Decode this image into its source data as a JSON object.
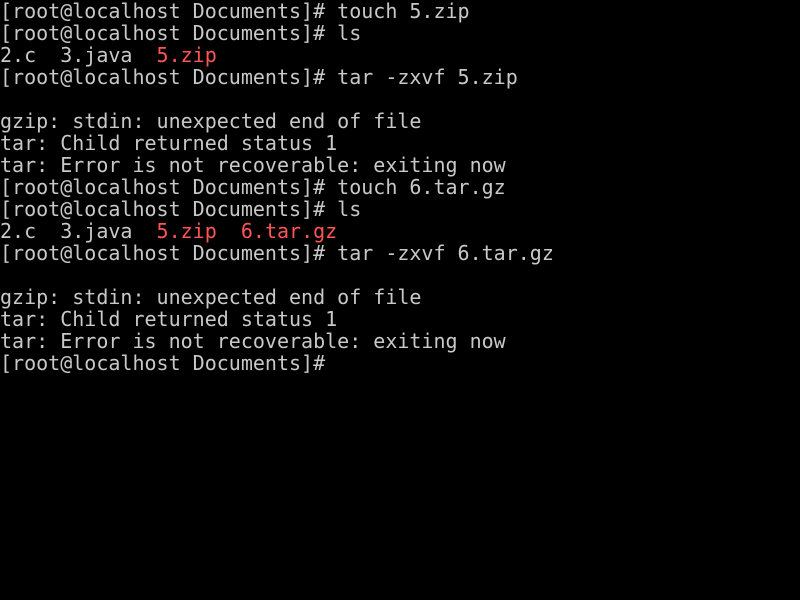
{
  "terminal": {
    "colors": {
      "background": "#000000",
      "foreground": "#c8c8c8",
      "archive": "#ff5555"
    },
    "lines": [
      [
        {
          "text": "[root@localhost Documents]# touch 5.zip"
        }
      ],
      [
        {
          "text": "[root@localhost Documents]# ls"
        }
      ],
      [
        {
          "text": "2.c  3.java  "
        },
        {
          "text": "5.zip",
          "color": "red"
        }
      ],
      [
        {
          "text": "[root@localhost Documents]# tar -zxvf 5.zip"
        }
      ],
      [],
      [
        {
          "text": "gzip: stdin: unexpected end of file"
        }
      ],
      [
        {
          "text": "tar: Child returned status 1"
        }
      ],
      [
        {
          "text": "tar: Error is not recoverable: exiting now"
        }
      ],
      [
        {
          "text": "[root@localhost Documents]# touch 6.tar.gz"
        }
      ],
      [
        {
          "text": "[root@localhost Documents]# ls"
        }
      ],
      [
        {
          "text": "2.c  3.java  "
        },
        {
          "text": "5.zip",
          "color": "red"
        },
        {
          "text": "  "
        },
        {
          "text": "6.tar.gz",
          "color": "red"
        }
      ],
      [
        {
          "text": "[root@localhost Documents]# tar -zxvf 6.tar.gz"
        }
      ],
      [],
      [
        {
          "text": "gzip: stdin: unexpected end of file"
        }
      ],
      [
        {
          "text": "tar: Child returned status 1"
        }
      ],
      [
        {
          "text": "tar: Error is not recoverable: exiting now"
        }
      ],
      [
        {
          "text": "[root@localhost Documents]#"
        }
      ]
    ]
  }
}
